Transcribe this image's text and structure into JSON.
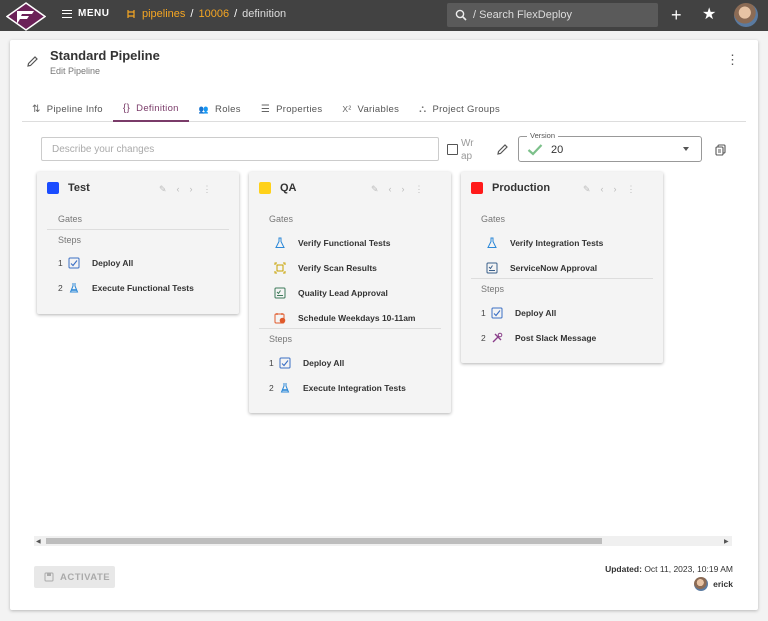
{
  "topbar": {
    "menu_label": "MENU",
    "breadcrumb": {
      "pipelines": "pipelines",
      "id": "10006",
      "current": "definition",
      "sep": "/"
    },
    "search_placeholder": "/ Search FlexDeploy",
    "plus": "+",
    "star": "★"
  },
  "header": {
    "title": "Standard Pipeline",
    "subtitle": "Edit Pipeline",
    "kebab": "⋮"
  },
  "tabs": [
    {
      "label": "Pipeline Info",
      "icon": "⇅"
    },
    {
      "label": "Definition",
      "icon": "{}"
    },
    {
      "label": "Roles",
      "icon": "👥"
    },
    {
      "label": "Properties",
      "icon": "☰"
    },
    {
      "label": "Variables",
      "icon": "X²"
    },
    {
      "label": "Project Groups",
      "icon": "⛬"
    }
  ],
  "toolbar": {
    "description_placeholder": "Describe your changes",
    "wrap_label": "Wrap",
    "version_label": "Version",
    "version_value": "20"
  },
  "stages": [
    {
      "name": "Test",
      "color": "#1a4cff",
      "gates_label": "Gates",
      "steps_label": "Steps",
      "gates": [],
      "steps": [
        {
          "num": "1",
          "label": "Deploy All",
          "icon": "deploy-icon"
        },
        {
          "num": "2",
          "label": "Execute Functional Tests",
          "icon": "test-icon"
        }
      ]
    },
    {
      "name": "QA",
      "color": "#ffd11a",
      "gates_label": "Gates",
      "steps_label": "Steps",
      "gates": [
        {
          "label": "Verify Functional Tests",
          "icon": "flask-icon"
        },
        {
          "label": "Verify Scan Results",
          "icon": "scan-icon"
        },
        {
          "label": "Quality Lead Approval",
          "icon": "approval-icon"
        },
        {
          "label": "Schedule Weekdays 10-11am",
          "icon": "schedule-icon"
        }
      ],
      "steps": [
        {
          "num": "1",
          "label": "Deploy All",
          "icon": "deploy-icon"
        },
        {
          "num": "2",
          "label": "Execute Integration Tests",
          "icon": "test-icon"
        }
      ]
    },
    {
      "name": "Production",
      "color": "#ff1a1a",
      "gates_label": "Gates",
      "steps_label": "Steps",
      "gates": [
        {
          "label": "Verify Integration Tests",
          "icon": "flask-icon"
        },
        {
          "label": "ServiceNow Approval",
          "icon": "approval-icon"
        }
      ],
      "steps": [
        {
          "num": "1",
          "label": "Deploy All",
          "icon": "deploy-icon"
        },
        {
          "num": "2",
          "label": "Post Slack Message",
          "icon": "tools-icon"
        }
      ]
    }
  ],
  "footer": {
    "activate_label": "ACTIVATE",
    "updated_label": "Updated:",
    "updated_value": "Oct 11, 2023, 10:19 AM",
    "user": "erick"
  }
}
